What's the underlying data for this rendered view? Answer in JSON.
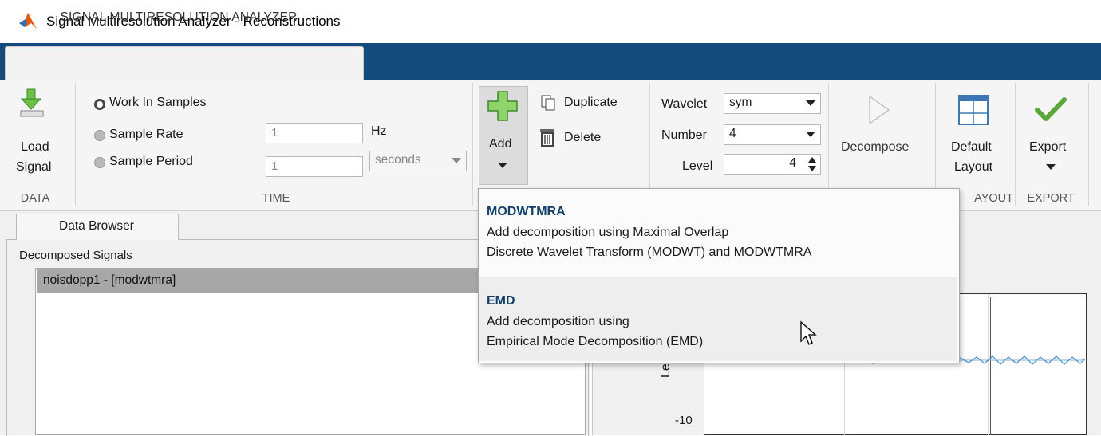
{
  "window": {
    "title": "Signal Multiresolution Analyzer - Reconstructions"
  },
  "tab": {
    "label": "SIGNAL MULTIRESOLUTION ANALYZER"
  },
  "toolstrip": {
    "data": {
      "load_line1": "Load",
      "load_line2": "Signal",
      "section": "DATA"
    },
    "time": {
      "work_in_samples": "Work In Samples",
      "sample_rate": "Sample Rate",
      "sample_period": "Sample Period",
      "sample_rate_value": "1",
      "sample_period_value": "1",
      "hz_unit": "Hz",
      "period_unit": "seconds",
      "section": "TIME"
    },
    "add": {
      "label": "Add",
      "duplicate": "Duplicate",
      "delete": "Delete"
    },
    "wavelet": {
      "wavelet_label": "Wavelet",
      "wavelet_value": "sym",
      "number_label": "Number",
      "number_value": "4",
      "level_label": "Level",
      "level_value": "4"
    },
    "decompose": {
      "label": "Decompose"
    },
    "layout": {
      "line1": "Default",
      "line2": "Layout",
      "section": "AYOUT"
    },
    "export": {
      "label": "Export",
      "section": "EXPORT"
    }
  },
  "add_menu": {
    "items": [
      {
        "title": "MODWTMRA",
        "desc1": "Add decomposition using Maximal Overlap",
        "desc2": "Discrete Wavelet Transform (MODWT) and MODWTMRA"
      },
      {
        "title": "EMD",
        "desc1": "Add decomposition using",
        "desc2": "Empirical Mode Decomposition (EMD)"
      }
    ]
  },
  "data_browser": {
    "tab": "Data Browser",
    "group": "Decomposed Signals",
    "items": [
      "noisdopp1 - [modwtmra]"
    ]
  },
  "plot": {
    "ylabel": "Le",
    "ytick_bottom": "-10"
  },
  "colors": {
    "tab_strip": "#144a7c",
    "menu_title": "#12406a",
    "plot_line": "#4a90c8",
    "export_check": "#5aa83a",
    "add_plus": "#6cc04a"
  }
}
